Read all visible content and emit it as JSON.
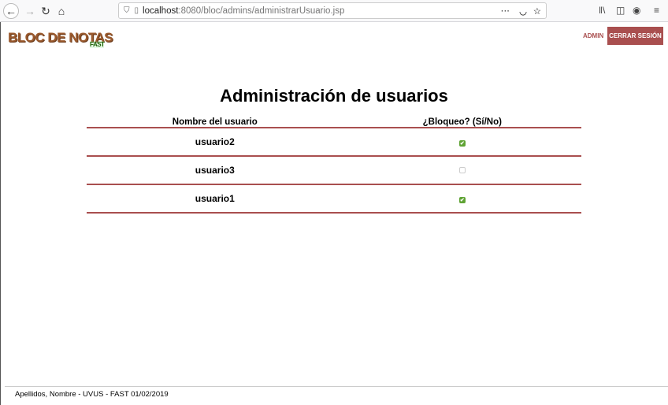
{
  "browser": {
    "url_host": "localhost",
    "url_path": ":8080/bloc/admins/administrarUsuario.jsp"
  },
  "header": {
    "logo": "BLOC DE NOTAS",
    "logo_sub": "FAST",
    "admin_label": "ADMIN",
    "logout_label": "CERRAR SESIÓN"
  },
  "page": {
    "title": "Administración de usuarios"
  },
  "table": {
    "headers": [
      "Nombre del usuario",
      "¿Bloqueo? (Sí/No)"
    ],
    "rows": [
      {
        "name": "usuario2",
        "blocked": true
      },
      {
        "name": "usuario3",
        "blocked": false
      },
      {
        "name": "usuario1",
        "blocked": true
      }
    ]
  },
  "footer": {
    "text": "Apellidos, Nombre - UVUS - FAST 01/02/2019"
  }
}
